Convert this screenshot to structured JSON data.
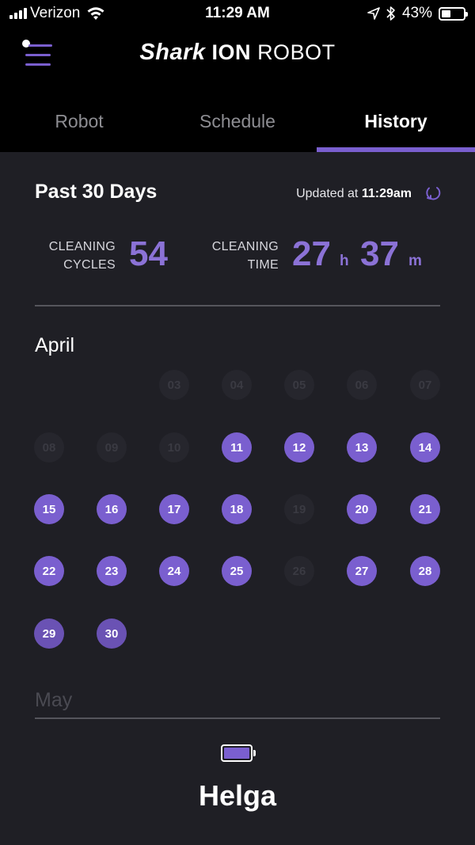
{
  "status_bar": {
    "carrier": "Verizon",
    "time": "11:29 AM",
    "battery": "43%",
    "battery_level": 0.43,
    "icons": [
      "signal-icon",
      "wifi-icon",
      "location-icon",
      "bluetooth-icon",
      "battery-icon"
    ]
  },
  "header": {
    "logo_part1": "Shark",
    "logo_part2": "ION",
    "logo_part3": "ROBOT",
    "menu_icon": "menu-icon"
  },
  "tabs": [
    {
      "label": "Robot",
      "active": false
    },
    {
      "label": "Schedule",
      "active": false
    },
    {
      "label": "History",
      "active": true
    }
  ],
  "history": {
    "period": "Past 30 Days",
    "updated_prefix": "Updated at",
    "updated_time": "11:29am",
    "refresh_icon": "refresh-icon",
    "cycles_label_line1": "CLEANING",
    "cycles_label_line2": "CYCLES",
    "cycles_value": "54",
    "time_label_line1": "CLEANING",
    "time_label_line2": "TIME",
    "time_hours": "27",
    "time_hours_unit": "h",
    "time_minutes": "37",
    "time_minutes_unit": "m"
  },
  "calendar": {
    "month1": "April",
    "month2": "May",
    "days": [
      {
        "label": "03",
        "cleaned": false
      },
      {
        "label": "04",
        "cleaned": false
      },
      {
        "label": "05",
        "cleaned": false
      },
      {
        "label": "06",
        "cleaned": false
      },
      {
        "label": "07",
        "cleaned": false
      },
      {
        "label": "08",
        "cleaned": false
      },
      {
        "label": "09",
        "cleaned": false
      },
      {
        "label": "10",
        "cleaned": false
      },
      {
        "label": "11",
        "cleaned": true
      },
      {
        "label": "12",
        "cleaned": true
      },
      {
        "label": "13",
        "cleaned": true
      },
      {
        "label": "14",
        "cleaned": true
      },
      {
        "label": "15",
        "cleaned": true
      },
      {
        "label": "16",
        "cleaned": true
      },
      {
        "label": "17",
        "cleaned": true
      },
      {
        "label": "18",
        "cleaned": true
      },
      {
        "label": "19",
        "cleaned": false
      },
      {
        "label": "20",
        "cleaned": true
      },
      {
        "label": "21",
        "cleaned": true
      },
      {
        "label": "22",
        "cleaned": true
      },
      {
        "label": "23",
        "cleaned": true
      },
      {
        "label": "24",
        "cleaned": true
      },
      {
        "label": "25",
        "cleaned": true
      },
      {
        "label": "26",
        "cleaned": false
      },
      {
        "label": "27",
        "cleaned": true
      },
      {
        "label": "28",
        "cleaned": true
      },
      {
        "label": "29",
        "cleaned": true
      },
      {
        "label": "30",
        "cleaned": true
      }
    ]
  },
  "robot": {
    "name": "Helga",
    "battery_icon": "battery-icon"
  },
  "colors": {
    "accent": "#7a5fcf",
    "background": "#1f1f25",
    "header_bg": "#000000"
  }
}
